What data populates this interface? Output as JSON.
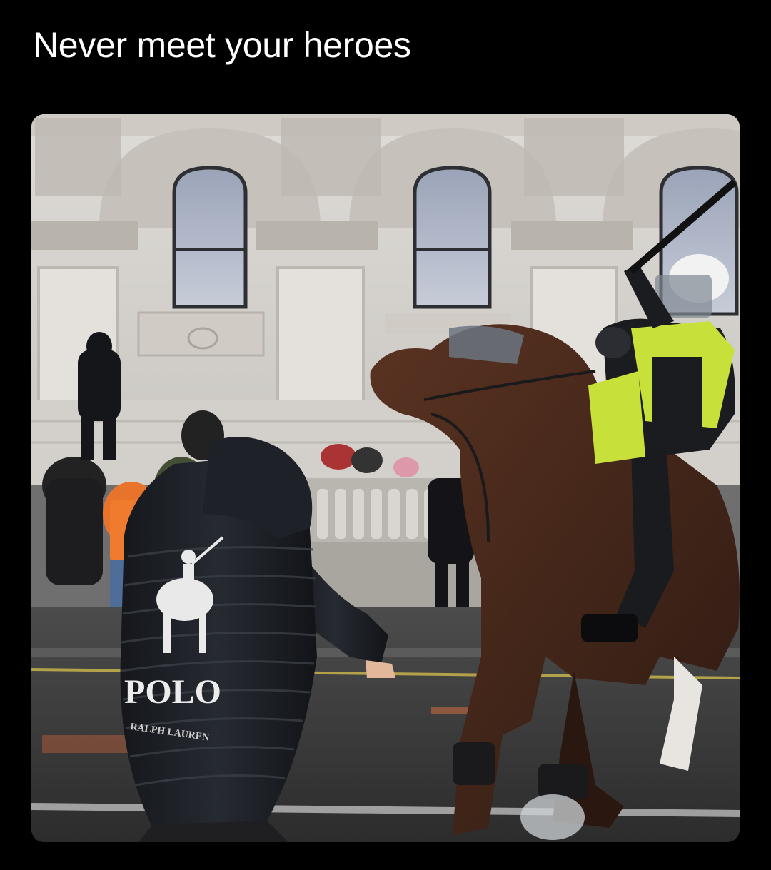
{
  "post": {
    "caption": "Never meet your heroes"
  },
  "photo": {
    "jacket_logo_text": "POLO",
    "jacket_logo_subtext": "RALPH LAUREN"
  },
  "colors": {
    "background": "#000000",
    "caption": "#ffffff",
    "hi_vis": "#c8e03a",
    "horse": "#4a2a1c",
    "building": "#d9d6d1"
  }
}
